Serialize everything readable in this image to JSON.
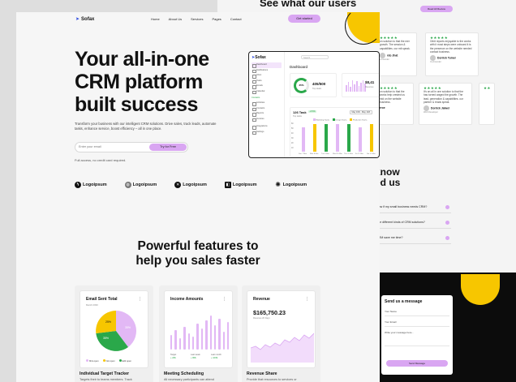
{
  "back": {
    "title": "See what our users",
    "pill": "Read All Review",
    "testimonials": [
      {
        "stars": "★★★★★",
        "text": "on solution to that the mer growth. The session & capabilities. our mit speak.",
        "name": "rdo Jhat",
        "role": "e Founder"
      },
      {
        "stars": "★★★★★",
        "text": "Orbit reports enjoyable to the works with it most steps were onboard it is the presence on the website needed contact business.",
        "name": "Dorrick Tumer",
        "role": "Co-Founder"
      },
      {
        "stars": "★★★★★",
        "text": "on solution to that the works help crested us mid on the website business.",
        "name": "rroe",
        "role": ""
      },
      {
        "stars": "★★★★★",
        "text": "It's an all in one solution to that the has turned waged the growth. The lead, generation & capabilities. our partner & reads speak.",
        "name": "Dorrick Jaiwel",
        "role": "Web Developer"
      }
    ],
    "know_title": "know\ned us",
    "faqs": [
      "How if my small business needs CRM?",
      "The different kinds of CRM solutions?",
      "CRM save me time?"
    ],
    "message": {
      "title": "Send us a message",
      "name_ph": "Your Name",
      "email_ph": "Your Email",
      "msg_ph": "Write your message here...",
      "button": "Send Message"
    }
  },
  "nav": {
    "logo": "Sofax",
    "links": [
      "Home",
      "About Us",
      "Services",
      "Pages",
      "Contact"
    ],
    "cta": "Get started"
  },
  "hero": {
    "line1": "Your all-in-one",
    "line2": "CRM platform",
    "line3": "built success",
    "subtitle": "Transform your business with our intelligent CRM solutions. Drive sales, track leads, automate tasks, enhance service, boost efficiency – all in one place.",
    "email_placeholder": "Enter your email",
    "try_button": "Try for Free",
    "no_card": "Full access, no credit card required."
  },
  "logos": [
    "Logoipsum",
    "Logoipsum",
    "Logoipsum",
    "Logoipsum",
    "Logoipsum"
  ],
  "dashboard": {
    "logo": "Sofax",
    "search": "Search",
    "title": "Dashboard",
    "nav": [
      "Dashboard",
      "Notifications",
      "Inbox",
      "Tasks",
      "Emails",
      "Calendar"
    ],
    "section": "Contacts",
    "nav2": [
      "Activities",
      "Contacts",
      "Reports",
      "Invoices"
    ],
    "nav3": [
      "Integrations",
      "Settings"
    ],
    "ring_value": "35%",
    "stat1_value": "405/500",
    "stat1_label": "Top deals",
    "stat2_value": "$8,41",
    "stat2_label": "Revenue",
    "chart_title": "126 Task",
    "chart_badge": "+5.5%",
    "chart_sub": "Top tasks",
    "select": "May 10th - May 14th",
    "legend": [
      "Marketing Teams",
      "Design Teams",
      "Production Teams"
    ],
    "y_ticks": [
      "60",
      "50",
      "40",
      "30",
      "20",
      "10",
      "0"
    ],
    "x_ticks": [
      "Sun 7 Mar",
      "Mon 8 Mar",
      "Tue 9 Mar",
      "Wed 10 Mar",
      "Thu 11 Mar",
      "Fri 12 Mar",
      "Sat 13 Mar"
    ],
    "colors": {
      "accent": "#d9a6f2",
      "green": "#2aa84a",
      "yellow": "#f7c600"
    }
  },
  "features": {
    "title_line1": "Powerful features to",
    "title_line2": "help you sales faster",
    "cards": [
      {
        "title": "Email Sent Total",
        "sub": "March 2030",
        "caption": "Individual Target Tracker",
        "desc": "Targets their to teams members. Track"
      },
      {
        "title": "Income Amounts",
        "sub": "",
        "caption": "Meeting Scheduling",
        "desc": "All necessary participants can attend"
      },
      {
        "title": "Revenue",
        "sub": "",
        "caption": "Revenue Share",
        "desc": "Provide that resources to services or"
      }
    ],
    "pie_labels": [
      "35%",
      "35%",
      "25%"
    ],
    "pie_legend": [
      "Mini open",
      "Not open",
      "Edit open"
    ],
    "income_legend": [
      {
        "label": "Target",
        "value": "+ 20$"
      },
      {
        "label": "Last week",
        "value": "+ 80$"
      },
      {
        "label": "Last month",
        "value": "+ 100$"
      }
    ],
    "revenue_value": "$165,750.23",
    "revenue_label": "Revenue 20 Days"
  }
}
